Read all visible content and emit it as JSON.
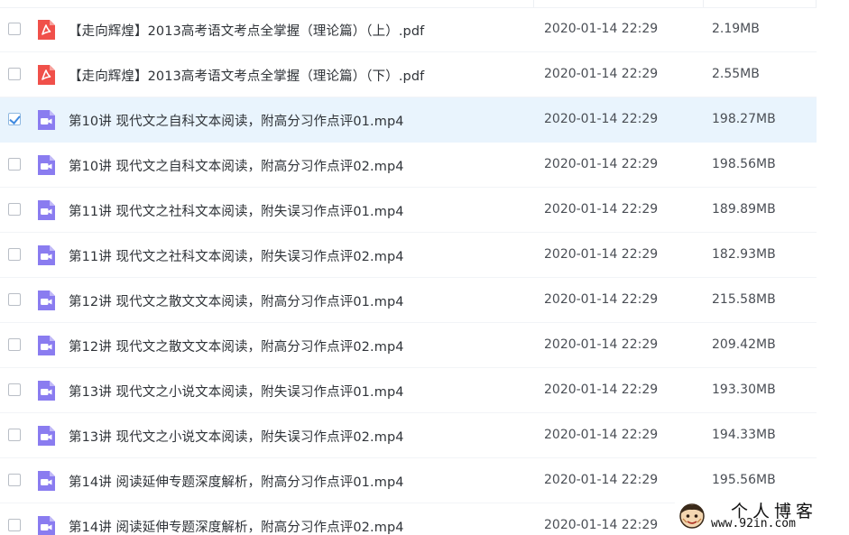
{
  "files": [
    {
      "name": "【走向辉煌】2013高考语文考点全掌握（理论篇）（上）.pdf",
      "type": "pdf",
      "date": "2020-01-14 22:29",
      "size": "2.19MB",
      "selected": false
    },
    {
      "name": "【走向辉煌】2013高考语文考点全掌握（理论篇）（下）.pdf",
      "type": "pdf",
      "date": "2020-01-14 22:29",
      "size": "2.55MB",
      "selected": false
    },
    {
      "name": "第10讲 现代文之自科文本阅读，附高分习作点评01.mp4",
      "type": "video",
      "date": "2020-01-14 22:29",
      "size": "198.27MB",
      "selected": true
    },
    {
      "name": "第10讲 现代文之自科文本阅读，附高分习作点评02.mp4",
      "type": "video",
      "date": "2020-01-14 22:29",
      "size": "198.56MB",
      "selected": false
    },
    {
      "name": "第11讲 现代文之社科文本阅读，附失误习作点评01.mp4",
      "type": "video",
      "date": "2020-01-14 22:29",
      "size": "189.89MB",
      "selected": false
    },
    {
      "name": "第11讲 现代文之社科文本阅读，附失误习作点评02.mp4",
      "type": "video",
      "date": "2020-01-14 22:29",
      "size": "182.93MB",
      "selected": false
    },
    {
      "name": "第12讲 现代文之散文文本阅读，附高分习作点评01.mp4",
      "type": "video",
      "date": "2020-01-14 22:29",
      "size": "215.58MB",
      "selected": false
    },
    {
      "name": "第12讲 现代文之散文文本阅读，附高分习作点评02.mp4",
      "type": "video",
      "date": "2020-01-14 22:29",
      "size": "209.42MB",
      "selected": false
    },
    {
      "name": "第13讲 现代文之小说文本阅读，附失误习作点评01.mp4",
      "type": "video",
      "date": "2020-01-14 22:29",
      "size": "193.30MB",
      "selected": false
    },
    {
      "name": "第13讲 现代文之小说文本阅读，附失误习作点评02.mp4",
      "type": "video",
      "date": "2020-01-14 22:29",
      "size": "194.33MB",
      "selected": false
    },
    {
      "name": "第14讲 阅读延伸专题深度解析，附高分习作点评01.mp4",
      "type": "video",
      "date": "2020-01-14 22:29",
      "size": "195.56MB",
      "selected": false
    },
    {
      "name": "第14讲 阅读延伸专题深度解析，附高分习作点评02.mp4",
      "type": "video",
      "date": "2020-01-14 22:29",
      "size": "",
      "selected": false
    }
  ],
  "icons": {
    "pdf": "pdf-file-icon",
    "video": "video-file-icon"
  },
  "colors": {
    "pdf_icon": "#f0504a",
    "video_icon": "#8a7cf0",
    "selected_row": "#e9f4fd",
    "checkbox_check": "#3f8ae0"
  },
  "watermark": {
    "title": "个人博客",
    "url": "www.92in.com"
  }
}
